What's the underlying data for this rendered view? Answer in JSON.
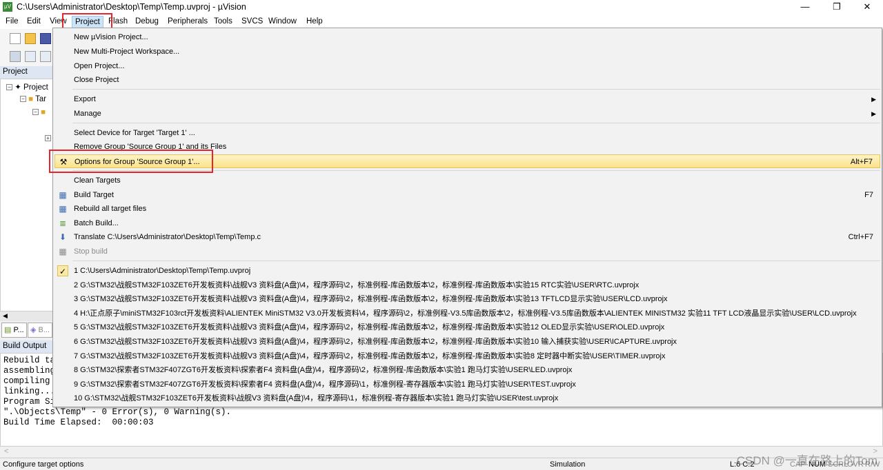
{
  "window": {
    "title": "C:\\Users\\Administrator\\Desktop\\Temp\\Temp.uvproj - µVision",
    "min": "—",
    "max": "❐",
    "close": "✕"
  },
  "menubar": [
    "File",
    "Edit",
    "View",
    "Project",
    "Flash",
    "Debug",
    "Peripherals",
    "Tools",
    "SVCS",
    "Window",
    "Help"
  ],
  "project_pane": {
    "header": "Project",
    "tree": [
      "Project",
      "Tar",
      ""
    ],
    "tabs": [
      "P...",
      "B..."
    ]
  },
  "build_output": {
    "header": "Build Output",
    "lines": [
      "Rebuild ta",
      "assembling",
      "compiling ",
      "linking...",
      "Program Si",
      "\".\\Objects\\Temp\" - 0 Error(s), 0 Warning(s).",
      "Build Time Elapsed:  00:00:03"
    ]
  },
  "project_menu": {
    "items": [
      {
        "label": "New µVision Project..."
      },
      {
        "label": "New Multi-Project Workspace..."
      },
      {
        "label": "Open Project..."
      },
      {
        "label": "Close Project"
      },
      {
        "label": "Export",
        "submenu": "▶"
      },
      {
        "label": "Manage",
        "submenu": "▶"
      },
      {
        "label": "Select Device for Target 'Target 1' ..."
      },
      {
        "label": "Remove Group 'Source Group 1' and its Files"
      },
      {
        "label": "Options for Group 'Source Group 1'...",
        "shortcut": "Alt+F7"
      },
      {
        "label": "Clean Targets"
      },
      {
        "label": "Build Target",
        "shortcut": "F7"
      },
      {
        "label": "Rebuild all target files"
      },
      {
        "label": "Batch Build..."
      },
      {
        "label": "Translate C:\\Users\\Administrator\\Desktop\\Temp\\Temp.c",
        "shortcut": "Ctrl+F7"
      },
      {
        "label": "Stop build"
      }
    ],
    "recent": [
      "1 C:\\Users\\Administrator\\Desktop\\Temp\\Temp.uvproj",
      "2 G:\\STM32\\战舰STM32F103ZET6开发板资料\\战舰V3 资料盘(A盘)\\4，程序源码\\2，标准例程-库函数版本\\2，标准例程-库函数版本\\实验15 RTC实验\\USER\\RTC.uvprojx",
      "3 G:\\STM32\\战舰STM32F103ZET6开发板资料\\战舰V3 资料盘(A盘)\\4，程序源码\\2，标准例程-库函数版本\\2，标准例程-库函数版本\\实验13 TFTLCD显示实验\\USER\\LCD.uvprojx",
      "4 H:\\正点原子\\miniSTM32F103rct开发板资料\\ALIENTEK MiniSTM32 V3.0开发板资料\\4，程序源码\\2，标准例程-V3.5库函数版本\\2，标准例程-V3.5库函数版本\\ALIENTEK MINISTM32 实验11 TFT LCD液晶显示实验\\USER\\LCD.uvprojx",
      "5 G:\\STM32\\战舰STM32F103ZET6开发板资料\\战舰V3 资料盘(A盘)\\4，程序源码\\2，标准例程-库函数版本\\2，标准例程-库函数版本\\实验12 OLED显示实验\\USER\\OLED.uvprojx",
      "6 G:\\STM32\\战舰STM32F103ZET6开发板资料\\战舰V3 资料盘(A盘)\\4，程序源码\\2，标准例程-库函数版本\\2，标准例程-库函数版本\\实验10 输入捕获实验\\USER\\ICAPTURE.uvprojx",
      "7 G:\\STM32\\战舰STM32F103ZET6开发板资料\\战舰V3 资料盘(A盘)\\4，程序源码\\2，标准例程-库函数版本\\2，标准例程-库函数版本\\实验8 定时器中断实验\\USER\\TIMER.uvprojx",
      "8 G:\\STM32\\探索者STM32F407ZGT6开发板资料\\探索者F4 资料盘(A盘)\\4，程序源码\\2，标准例程-库函数版本\\实验1 跑马灯实验\\USER\\LED.uvprojx",
      "9 G:\\STM32\\探索者STM32F407ZGT6开发板资料\\探索者F4 资料盘(A盘)\\4，程序源码\\1，标准例程-寄存器版本\\实验1 跑马灯实验\\USER\\TEST.uvprojx",
      "10 G:\\STM32\\战舰STM32F103ZET6开发板资料\\战舰V3 资料盘(A盘)\\4，程序源码\\1，标准例程-寄存器版本\\实验1 跑马灯实验\\USER\\test.uvprojx"
    ]
  },
  "statusbar": {
    "message": "Configure target options",
    "mode": "Simulation",
    "position": "L:6 C:2",
    "indicators": [
      "CAP",
      "NUM",
      "SCRL",
      "OVR",
      "R/W"
    ]
  },
  "watermark": "CSDN @一直在路上的Tom",
  "colors": {
    "highlight": "#fbe38a",
    "annotation": "#e8232a"
  }
}
